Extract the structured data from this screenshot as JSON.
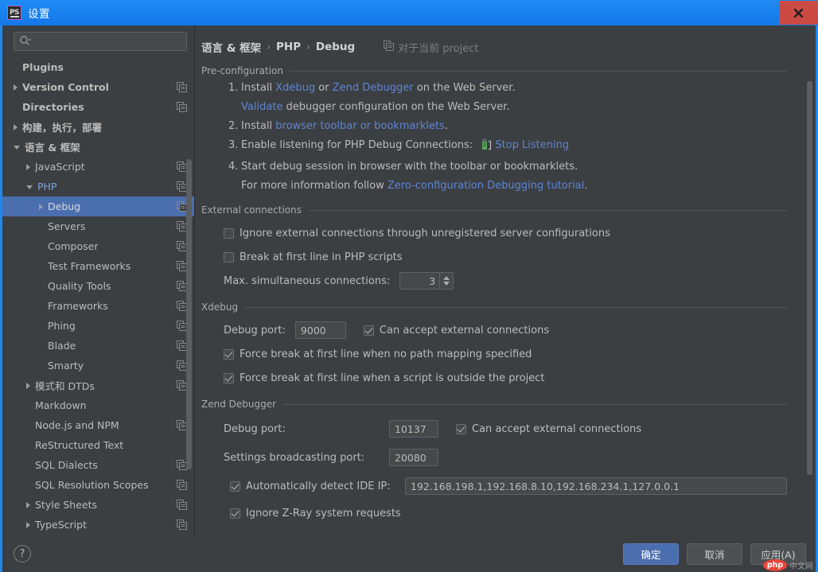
{
  "window": {
    "title": "设置",
    "app_icon": "phpstorm-icon",
    "close_label": "×",
    "accent_blue": "#1e88ef",
    "panel_bg": "#3c3f41",
    "selection_blue": "#4b6eaf",
    "link_blue": "#5c84d6"
  },
  "sidebar": {
    "search": {
      "placeholder": "",
      "value": "",
      "icon": "search-icon"
    },
    "items": [
      {
        "label": "Plugins",
        "indent": 0,
        "arrow": "none",
        "bold": true,
        "copy": false,
        "selected": false
      },
      {
        "label": "Version Control",
        "indent": 0,
        "arrow": "right",
        "bold": true,
        "copy": true,
        "selected": false
      },
      {
        "label": "Directories",
        "indent": 0,
        "arrow": "none",
        "bold": true,
        "copy": true,
        "selected": false
      },
      {
        "label": "构建，执行，部署",
        "indent": 0,
        "arrow": "right",
        "bold": true,
        "copy": false,
        "selected": false
      },
      {
        "label": "语言 & 框架",
        "indent": 0,
        "arrow": "down",
        "bold": true,
        "copy": false,
        "selected": false
      },
      {
        "label": "JavaScript",
        "indent": 1,
        "arrow": "right",
        "bold": false,
        "copy": true,
        "selected": false
      },
      {
        "label": "PHP",
        "indent": 1,
        "arrow": "down",
        "bold": false,
        "copy": true,
        "selected": false,
        "blue": true
      },
      {
        "label": "Debug",
        "indent": 2,
        "arrow": "right",
        "bold": false,
        "copy": true,
        "selected": true
      },
      {
        "label": "Servers",
        "indent": 2,
        "arrow": "none",
        "bold": false,
        "copy": true,
        "selected": false
      },
      {
        "label": "Composer",
        "indent": 2,
        "arrow": "none",
        "bold": false,
        "copy": true,
        "selected": false
      },
      {
        "label": "Test Frameworks",
        "indent": 2,
        "arrow": "none",
        "bold": false,
        "copy": true,
        "selected": false
      },
      {
        "label": "Quality Tools",
        "indent": 2,
        "arrow": "none",
        "bold": false,
        "copy": true,
        "selected": false
      },
      {
        "label": "Frameworks",
        "indent": 2,
        "arrow": "none",
        "bold": false,
        "copy": true,
        "selected": false
      },
      {
        "label": "Phing",
        "indent": 2,
        "arrow": "none",
        "bold": false,
        "copy": true,
        "selected": false
      },
      {
        "label": "Blade",
        "indent": 2,
        "arrow": "none",
        "bold": false,
        "copy": true,
        "selected": false
      },
      {
        "label": "Smarty",
        "indent": 2,
        "arrow": "none",
        "bold": false,
        "copy": true,
        "selected": false
      },
      {
        "label": "模式和 DTDs",
        "indent": 1,
        "arrow": "right",
        "bold": false,
        "copy": true,
        "selected": false
      },
      {
        "label": "Markdown",
        "indent": 1,
        "arrow": "none",
        "bold": false,
        "copy": false,
        "selected": false
      },
      {
        "label": "Node.js and NPM",
        "indent": 1,
        "arrow": "none",
        "bold": false,
        "copy": true,
        "selected": false
      },
      {
        "label": "ReStructured Text",
        "indent": 1,
        "arrow": "none",
        "bold": false,
        "copy": false,
        "selected": false
      },
      {
        "label": "SQL Dialects",
        "indent": 1,
        "arrow": "none",
        "bold": false,
        "copy": true,
        "selected": false
      },
      {
        "label": "SQL Resolution Scopes",
        "indent": 1,
        "arrow": "none",
        "bold": false,
        "copy": true,
        "selected": false
      },
      {
        "label": "Style Sheets",
        "indent": 1,
        "arrow": "right",
        "bold": false,
        "copy": true,
        "selected": false
      },
      {
        "label": "TypeScript",
        "indent": 1,
        "arrow": "right",
        "bold": false,
        "copy": true,
        "selected": false
      }
    ]
  },
  "breadcrumb": {
    "parts": [
      "语言 & 框架",
      "PHP",
      "Debug"
    ],
    "separator": "›",
    "scope_hint": "对于当前 project",
    "scope_icon": "copy-icon"
  },
  "preconfiguration": {
    "title": "Pre-configuration",
    "items": [
      {
        "num": "1.",
        "prefix": "Install ",
        "link1": "Xdebug",
        "mid": " or ",
        "link2": "Zend Debugger",
        "suffix": " on the Web Server.",
        "sub_link": "Validate",
        "sub_text": " debugger configuration on the Web Server."
      },
      {
        "num": "2.",
        "prefix": "Install ",
        "link1": "browser toolbar or bookmarklets",
        "suffix": "."
      },
      {
        "num": "3.",
        "prefix": "Enable listening for PHP Debug Connections: ",
        "icon": "listening-phone-icon",
        "link1": "Stop Listening"
      },
      {
        "num": "4.",
        "prefix": "Start debug session in browser with the toolbar or bookmarklets.",
        "sub_prefix": "For more information follow ",
        "sub_link": "Zero-configuration Debugging tutorial",
        "sub_suffix": "."
      }
    ]
  },
  "external_connections": {
    "title": "External connections",
    "ignore_unregistered": {
      "label": "Ignore external connections through unregistered server configurations",
      "checked": false
    },
    "break_first_line": {
      "label": "Break at first line in PHP scripts",
      "checked": false
    },
    "max_connections": {
      "label": "Max. simultaneous connections:",
      "value": "3"
    }
  },
  "xdebug": {
    "title": "Xdebug",
    "debug_port": {
      "label": "Debug port:",
      "value": "9000"
    },
    "can_accept": {
      "label": "Can accept external connections",
      "checked": true
    },
    "force_break_no_mapping": {
      "label": "Force break at first line when no path mapping specified",
      "checked": true
    },
    "force_break_outside": {
      "label": "Force break at first line when a script is outside the project",
      "checked": true
    }
  },
  "zend_debugger": {
    "title": "Zend Debugger",
    "debug_port": {
      "label": "Debug port:",
      "value": "10137"
    },
    "can_accept": {
      "label": "Can accept external connections",
      "checked": true
    },
    "broadcast_port": {
      "label": "Settings broadcasting port:",
      "value": "20080"
    },
    "auto_detect_ip": {
      "label": "Automatically detect IDE IP:",
      "checked": true,
      "value": "192.168.198.1,192.168.8.10,192.168.234.1,127.0.0.1"
    },
    "ignore_zray": {
      "label": "Ignore Z-Ray system requests",
      "checked": true
    }
  },
  "footer": {
    "help": "?",
    "ok": "确定",
    "cancel": "取消",
    "apply": "应用(A)",
    "watermark_logo": "php",
    "watermark_text": "中文网"
  }
}
